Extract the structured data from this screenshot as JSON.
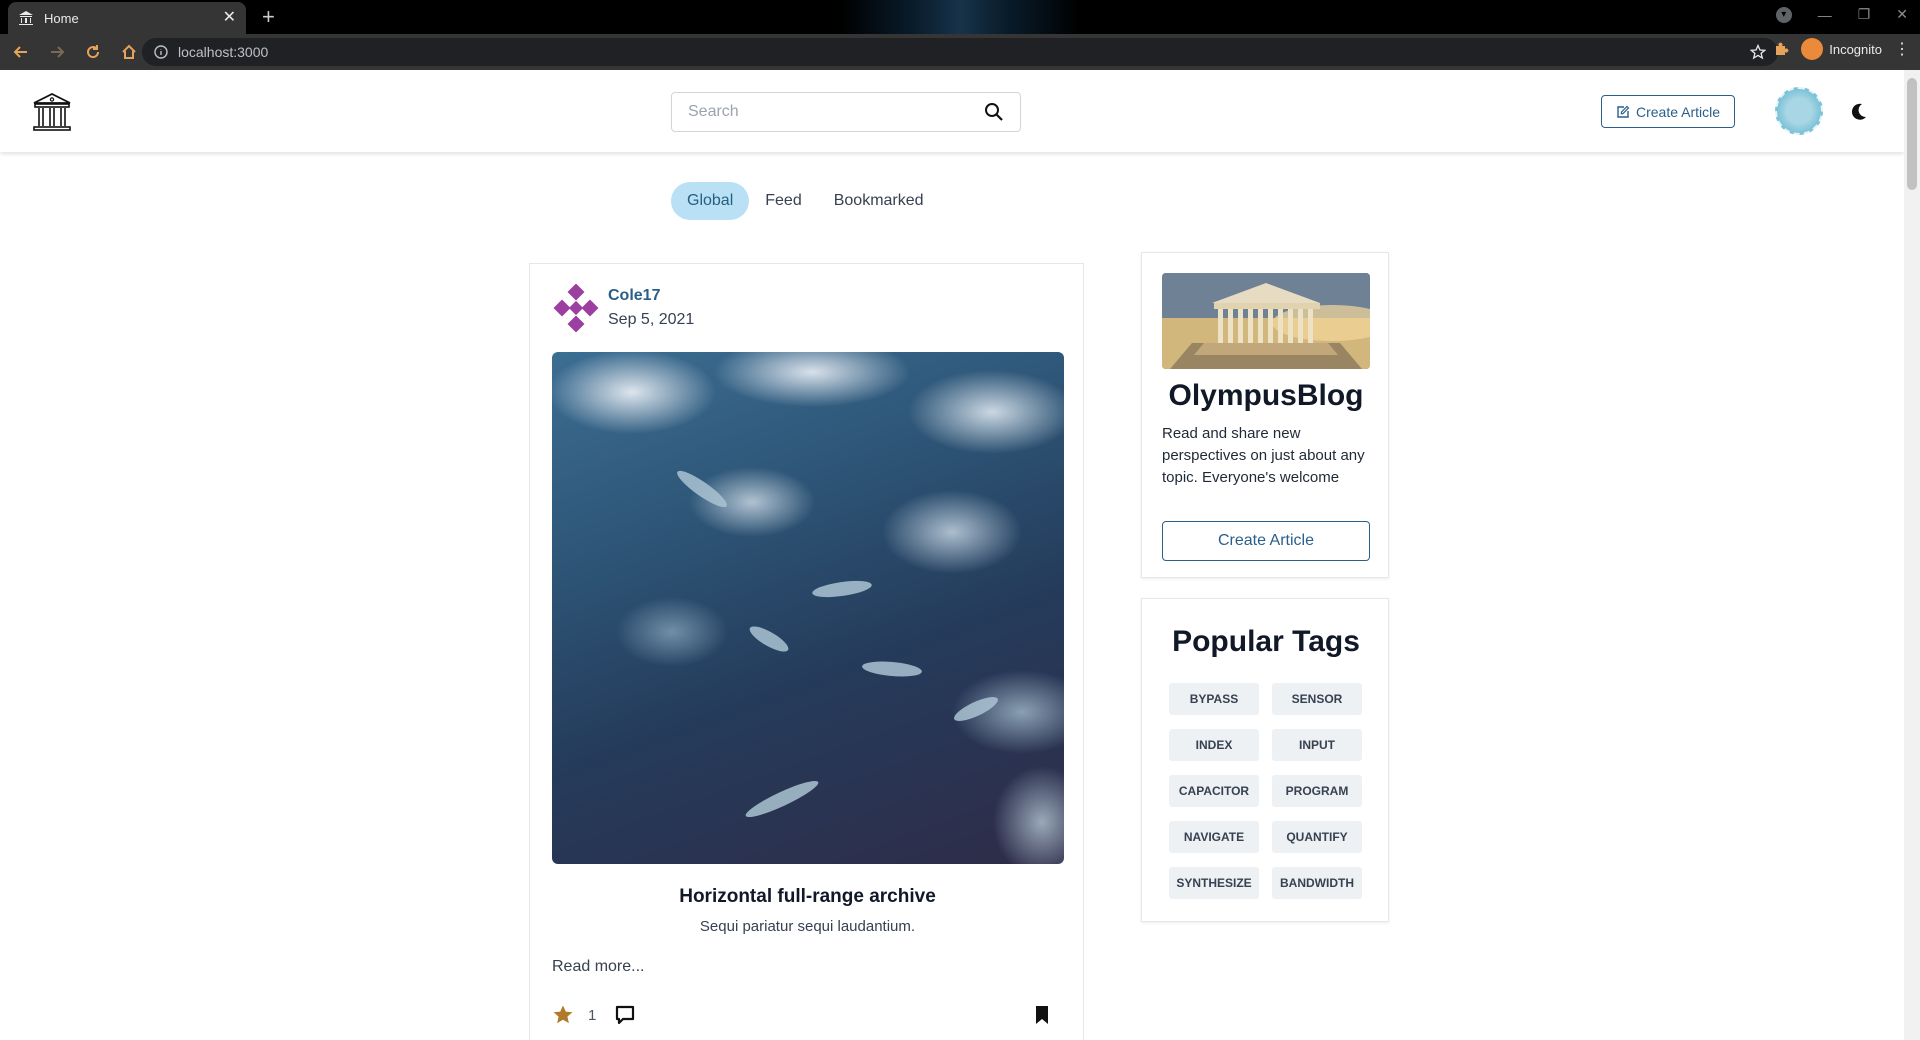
{
  "browser": {
    "tab_title": "Home",
    "url": "localhost:3000",
    "incognito_label": "Incognito"
  },
  "navbar": {
    "search_placeholder": "Search",
    "create_article_label": "Create Article"
  },
  "feed_tabs": [
    {
      "label": "Global",
      "active": true
    },
    {
      "label": "Feed",
      "active": false
    },
    {
      "label": "Bookmarked",
      "active": false
    }
  ],
  "article": {
    "author": "Cole17",
    "date": "Sep 5, 2021",
    "title": "Horizontal full-range archive",
    "description": "Sequi pariatur sequi laudantium.",
    "read_more": "Read more...",
    "favorites_count": "1"
  },
  "sidebar": {
    "blog_name": "OlympusBlog",
    "blog_description": "Read and share new perspectives on just about any topic. Everyone's welcome",
    "create_article_label": "Create Article",
    "tags_title": "Popular Tags",
    "tags": [
      "BYPASS",
      "SENSOR",
      "INDEX",
      "INPUT",
      "CAPACITOR",
      "PROGRAM",
      "NAVIGATE",
      "QUANTIFY",
      "SYNTHESIZE",
      "BANDWIDTH"
    ]
  },
  "colors": {
    "accent": "#2b5f8a",
    "active_tab_bg": "#bae0f5",
    "star": "#b07a2a"
  }
}
